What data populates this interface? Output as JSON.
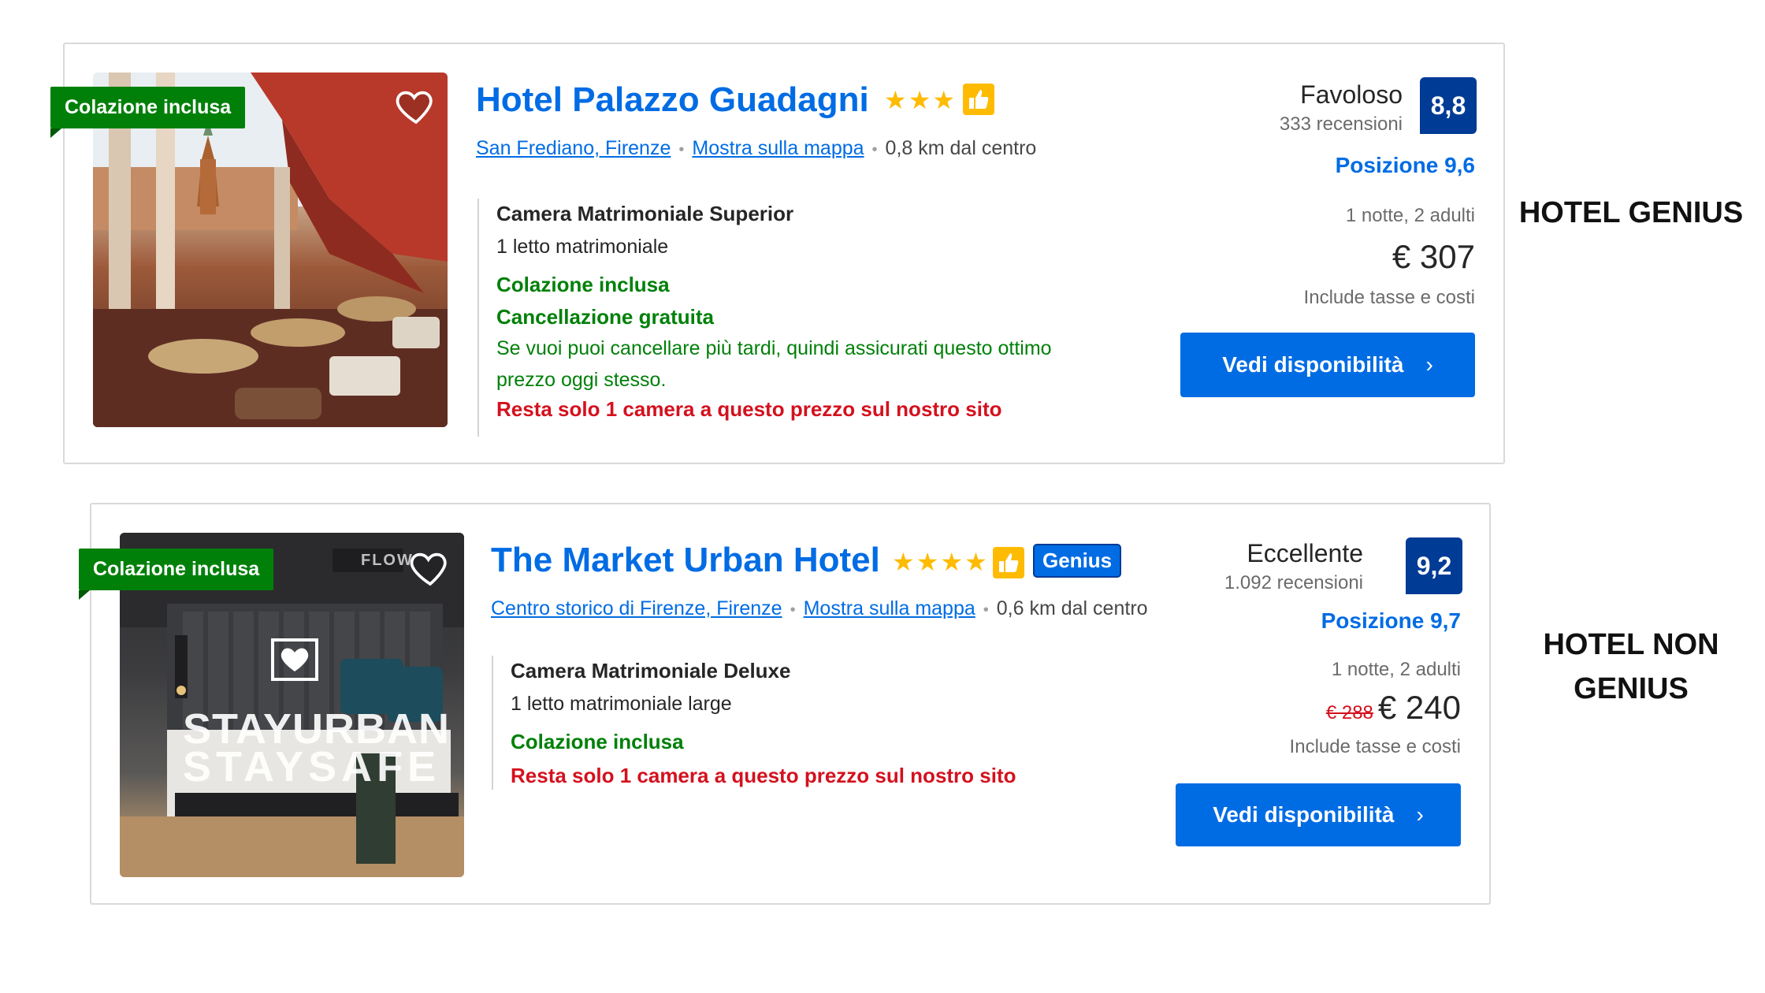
{
  "labels": {
    "genius": "HOTEL GENIUS",
    "non_genius_line1": "HOTEL NON",
    "non_genius_line2": "GENIUS"
  },
  "hotels": [
    {
      "badge": "Colazione inclusa",
      "name": "Hotel Palazzo Guadagni",
      "stars": "★★★",
      "star_count": 3,
      "genius_label": "",
      "location_link": "San Frediano, Firenze",
      "map_link": "Mostra sulla mappa",
      "distance": "0,8 km dal centro",
      "room_type": "Camera Matrimoniale Superior",
      "bed": "1 letto matrimoniale",
      "breakfast": "Colazione inclusa",
      "cancellation": "Cancellazione gratuita",
      "cancellation_note": "Se vuoi puoi cancellare più tardi, quindi assicurati questo ottimo prezzo oggi stesso.",
      "scarcity": "Resta solo 1 camera a questo prezzo sul nostro sito",
      "review_word": "Favoloso",
      "review_count": "333 recensioni",
      "score": "8,8",
      "position_score": "Posizione 9,6",
      "stay_info": "1 notte, 2 adulti",
      "old_price": "",
      "price": "€ 307",
      "tax_info": "Include tasse e costi",
      "cta": "Vedi disponibilità",
      "cta_chevron": "›"
    },
    {
      "badge": "Colazione inclusa",
      "name": "The Market Urban Hotel",
      "stars": "★★★★",
      "star_count": 4,
      "genius_label": "Genius",
      "location_link": "Centro storico di Firenze, Firenze",
      "map_link": "Mostra sulla mappa",
      "distance": "0,6 km dal centro",
      "room_type": "Camera Matrimoniale Deluxe",
      "bed": "1 letto matrimoniale large",
      "breakfast": "Colazione inclusa",
      "scarcity": "Resta solo 1 camera a questo prezzo sul nostro sito",
      "review_word": "Eccellente",
      "review_count": "1.092 recensioni",
      "score": "9,2",
      "position_score": "Posizione 9,7",
      "stay_info": "1 notte, 2 adulti",
      "old_price": "€ 288",
      "price": "€ 240",
      "tax_info": "Include tasse e costi",
      "cta": "Vedi disponibilità",
      "cta_chevron": "›",
      "photo_text_1": "STAYURBAN",
      "photo_text_2": "STAYSAFE",
      "photo_sign": "FLOW"
    }
  ],
  "icons": {
    "heart": "heart-icon",
    "thumb": "thumbs-up-icon",
    "chevron": "chevron-right-icon"
  },
  "colors": {
    "brand_blue": "#006ce4",
    "score_navy": "#003b95",
    "green": "#008009",
    "red": "#d4111e",
    "star_yellow": "#febb02"
  }
}
